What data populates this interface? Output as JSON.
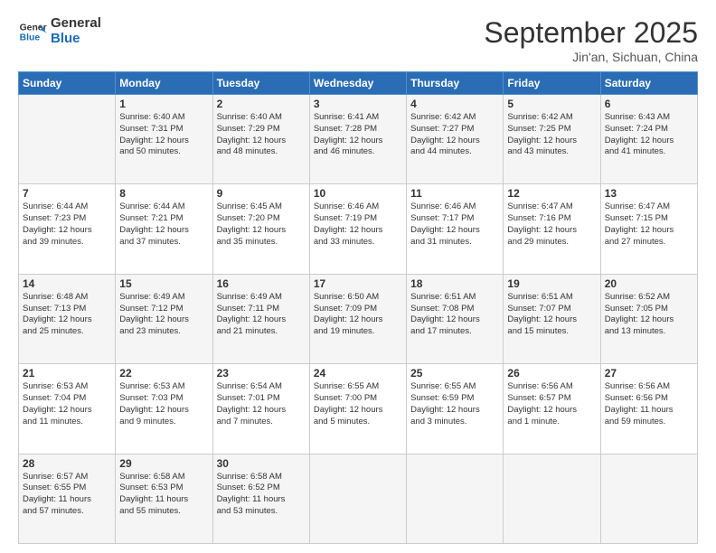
{
  "header": {
    "logo_general": "General",
    "logo_blue": "Blue",
    "month": "September 2025",
    "location": "Jin'an, Sichuan, China"
  },
  "weekdays": [
    "Sunday",
    "Monday",
    "Tuesday",
    "Wednesday",
    "Thursday",
    "Friday",
    "Saturday"
  ],
  "weeks": [
    [
      {
        "day": "",
        "lines": []
      },
      {
        "day": "1",
        "lines": [
          "Sunrise: 6:40 AM",
          "Sunset: 7:31 PM",
          "Daylight: 12 hours",
          "and 50 minutes."
        ]
      },
      {
        "day": "2",
        "lines": [
          "Sunrise: 6:40 AM",
          "Sunset: 7:29 PM",
          "Daylight: 12 hours",
          "and 48 minutes."
        ]
      },
      {
        "day": "3",
        "lines": [
          "Sunrise: 6:41 AM",
          "Sunset: 7:28 PM",
          "Daylight: 12 hours",
          "and 46 minutes."
        ]
      },
      {
        "day": "4",
        "lines": [
          "Sunrise: 6:42 AM",
          "Sunset: 7:27 PM",
          "Daylight: 12 hours",
          "and 44 minutes."
        ]
      },
      {
        "day": "5",
        "lines": [
          "Sunrise: 6:42 AM",
          "Sunset: 7:25 PM",
          "Daylight: 12 hours",
          "and 43 minutes."
        ]
      },
      {
        "day": "6",
        "lines": [
          "Sunrise: 6:43 AM",
          "Sunset: 7:24 PM",
          "Daylight: 12 hours",
          "and 41 minutes."
        ]
      }
    ],
    [
      {
        "day": "7",
        "lines": [
          "Sunrise: 6:44 AM",
          "Sunset: 7:23 PM",
          "Daylight: 12 hours",
          "and 39 minutes."
        ]
      },
      {
        "day": "8",
        "lines": [
          "Sunrise: 6:44 AM",
          "Sunset: 7:21 PM",
          "Daylight: 12 hours",
          "and 37 minutes."
        ]
      },
      {
        "day": "9",
        "lines": [
          "Sunrise: 6:45 AM",
          "Sunset: 7:20 PM",
          "Daylight: 12 hours",
          "and 35 minutes."
        ]
      },
      {
        "day": "10",
        "lines": [
          "Sunrise: 6:46 AM",
          "Sunset: 7:19 PM",
          "Daylight: 12 hours",
          "and 33 minutes."
        ]
      },
      {
        "day": "11",
        "lines": [
          "Sunrise: 6:46 AM",
          "Sunset: 7:17 PM",
          "Daylight: 12 hours",
          "and 31 minutes."
        ]
      },
      {
        "day": "12",
        "lines": [
          "Sunrise: 6:47 AM",
          "Sunset: 7:16 PM",
          "Daylight: 12 hours",
          "and 29 minutes."
        ]
      },
      {
        "day": "13",
        "lines": [
          "Sunrise: 6:47 AM",
          "Sunset: 7:15 PM",
          "Daylight: 12 hours",
          "and 27 minutes."
        ]
      }
    ],
    [
      {
        "day": "14",
        "lines": [
          "Sunrise: 6:48 AM",
          "Sunset: 7:13 PM",
          "Daylight: 12 hours",
          "and 25 minutes."
        ]
      },
      {
        "day": "15",
        "lines": [
          "Sunrise: 6:49 AM",
          "Sunset: 7:12 PM",
          "Daylight: 12 hours",
          "and 23 minutes."
        ]
      },
      {
        "day": "16",
        "lines": [
          "Sunrise: 6:49 AM",
          "Sunset: 7:11 PM",
          "Daylight: 12 hours",
          "and 21 minutes."
        ]
      },
      {
        "day": "17",
        "lines": [
          "Sunrise: 6:50 AM",
          "Sunset: 7:09 PM",
          "Daylight: 12 hours",
          "and 19 minutes."
        ]
      },
      {
        "day": "18",
        "lines": [
          "Sunrise: 6:51 AM",
          "Sunset: 7:08 PM",
          "Daylight: 12 hours",
          "and 17 minutes."
        ]
      },
      {
        "day": "19",
        "lines": [
          "Sunrise: 6:51 AM",
          "Sunset: 7:07 PM",
          "Daylight: 12 hours",
          "and 15 minutes."
        ]
      },
      {
        "day": "20",
        "lines": [
          "Sunrise: 6:52 AM",
          "Sunset: 7:05 PM",
          "Daylight: 12 hours",
          "and 13 minutes."
        ]
      }
    ],
    [
      {
        "day": "21",
        "lines": [
          "Sunrise: 6:53 AM",
          "Sunset: 7:04 PM",
          "Daylight: 12 hours",
          "and 11 minutes."
        ]
      },
      {
        "day": "22",
        "lines": [
          "Sunrise: 6:53 AM",
          "Sunset: 7:03 PM",
          "Daylight: 12 hours",
          "and 9 minutes."
        ]
      },
      {
        "day": "23",
        "lines": [
          "Sunrise: 6:54 AM",
          "Sunset: 7:01 PM",
          "Daylight: 12 hours",
          "and 7 minutes."
        ]
      },
      {
        "day": "24",
        "lines": [
          "Sunrise: 6:55 AM",
          "Sunset: 7:00 PM",
          "Daylight: 12 hours",
          "and 5 minutes."
        ]
      },
      {
        "day": "25",
        "lines": [
          "Sunrise: 6:55 AM",
          "Sunset: 6:59 PM",
          "Daylight: 12 hours",
          "and 3 minutes."
        ]
      },
      {
        "day": "26",
        "lines": [
          "Sunrise: 6:56 AM",
          "Sunset: 6:57 PM",
          "Daylight: 12 hours",
          "and 1 minute."
        ]
      },
      {
        "day": "27",
        "lines": [
          "Sunrise: 6:56 AM",
          "Sunset: 6:56 PM",
          "Daylight: 11 hours",
          "and 59 minutes."
        ]
      }
    ],
    [
      {
        "day": "28",
        "lines": [
          "Sunrise: 6:57 AM",
          "Sunset: 6:55 PM",
          "Daylight: 11 hours",
          "and 57 minutes."
        ]
      },
      {
        "day": "29",
        "lines": [
          "Sunrise: 6:58 AM",
          "Sunset: 6:53 PM",
          "Daylight: 11 hours",
          "and 55 minutes."
        ]
      },
      {
        "day": "30",
        "lines": [
          "Sunrise: 6:58 AM",
          "Sunset: 6:52 PM",
          "Daylight: 11 hours",
          "and 53 minutes."
        ]
      },
      {
        "day": "",
        "lines": []
      },
      {
        "day": "",
        "lines": []
      },
      {
        "day": "",
        "lines": []
      },
      {
        "day": "",
        "lines": []
      }
    ]
  ]
}
